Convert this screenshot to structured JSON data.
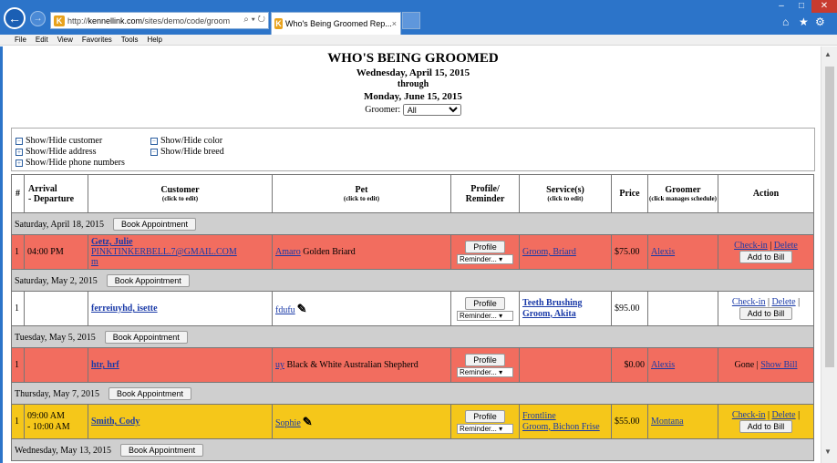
{
  "browser": {
    "back_icon": "back-arrow-icon",
    "forward_icon": "forward-arrow-icon",
    "url_prefix": "http://",
    "url_host": "kennellink.com",
    "url_path": "/sites/demo/code/groom",
    "url_tools": "⌕ ▾ ↻",
    "tab_title": "Who's Being Groomed Rep...",
    "tab_close": "×",
    "win_min": "–",
    "win_max": "□",
    "win_close": "✕",
    "home_icon": "⌂",
    "star_icon": "★",
    "gear_icon": "⚙"
  },
  "menu": [
    "File",
    "Edit",
    "View",
    "Favorites",
    "Tools",
    "Help"
  ],
  "report": {
    "title": "WHO'S BEING GROOMED",
    "start_date": "Wednesday, April 15, 2015",
    "through": "through",
    "end_date": "Monday, June 15, 2015",
    "groomer_label": "Groomer:",
    "groomer_value": "All"
  },
  "toggles": {
    "customer": {
      "box": "−",
      "label": "Show/Hide customer"
    },
    "address": {
      "box": "+",
      "label": "Show/Hide address"
    },
    "phone": {
      "box": "+",
      "label": "Show/Hide phone numbers"
    },
    "color": {
      "box": "−",
      "label": "Show/Hide color"
    },
    "breed": {
      "box": "−",
      "label": "Show/Hide breed"
    }
  },
  "columns": {
    "num": "#",
    "arrival": "Arrival",
    "departure": "- Departure",
    "customer": "Customer",
    "customer_sub": "(click to edit)",
    "pet": "Pet",
    "pet_sub": "(click to edit)",
    "profile": "Profile/",
    "profile2": "Reminder",
    "service": "Service(s)",
    "service_sub": "(click to edit)",
    "price": "Price",
    "groomer": "Groomer",
    "groomer_sub": "(click manages schedule)",
    "action": "Action"
  },
  "book_label": "Book Appointment",
  "profile_label": "Profile",
  "reminder_label": "Reminder... ▾",
  "add_bill_label": "Add to Bill",
  "sections": [
    {
      "date": "Saturday, April 18, 2015",
      "appt": {
        "num": "1",
        "time1": "04:00 PM",
        "time2": "",
        "customer": "Getz, Julie",
        "customer2": "PINKTINKERBELL.7@GMAIL.COM",
        "customer3": "m",
        "pet_name": "Amaro",
        "pet_desc": "Golden Briard",
        "service1": "Groom, Briard",
        "service2": "",
        "price": "$75.00",
        "groomer": "Alexis",
        "act1": "Check-in",
        "act2": "Delete",
        "sep": "|"
      }
    },
    {
      "date": "Saturday, May 2, 2015",
      "appt": {
        "num": "1",
        "time1": "",
        "time2": "",
        "customer": "ferreiuyhd, isette",
        "customer2": "",
        "customer3": "",
        "pet_name": "fdufu",
        "pet_desc": "",
        "service1": "Teeth Brushing",
        "service2": "Groom, Akita",
        "price": "$95.00",
        "groomer": "",
        "act1": "Check-in",
        "act2": "Delete",
        "sep": "|"
      }
    },
    {
      "date": "Tuesday, May 5, 2015",
      "appt": {
        "num": "1",
        "time1": "",
        "time2": "",
        "customer": "htr, hrf",
        "customer2": "",
        "customer3": "",
        "pet_name": "uy",
        "pet_desc": "Black & White Australian Shepherd",
        "service1": "",
        "service2": "",
        "price": "$0.00",
        "groomer": "Alexis",
        "act1": "Gone",
        "act2": "Show Bill",
        "sep": "|"
      }
    },
    {
      "date": "Thursday, May 7, 2015",
      "appt": {
        "num": "1",
        "time1": "09:00 AM",
        "time2": "- 10:00 AM",
        "customer": "Smith, Cody",
        "customer2": "",
        "customer3": "",
        "pet_name": "Sophie",
        "pet_desc": "",
        "service1": "Frontline",
        "service2": "Groom, Bichon Frise",
        "price": "$55.00",
        "groomer": "Montana",
        "act1": "Check-in",
        "act2": "Delete",
        "sep": "|"
      }
    },
    {
      "date": "Wednesday, May 13, 2015"
    }
  ],
  "icons": {
    "pencil": "✎"
  },
  "colors": {
    "red_row": "#f26d5f",
    "yellow_row": "#f5c71a",
    "date_row": "#cfcfcf",
    "titlebar": "#2c74c9"
  }
}
